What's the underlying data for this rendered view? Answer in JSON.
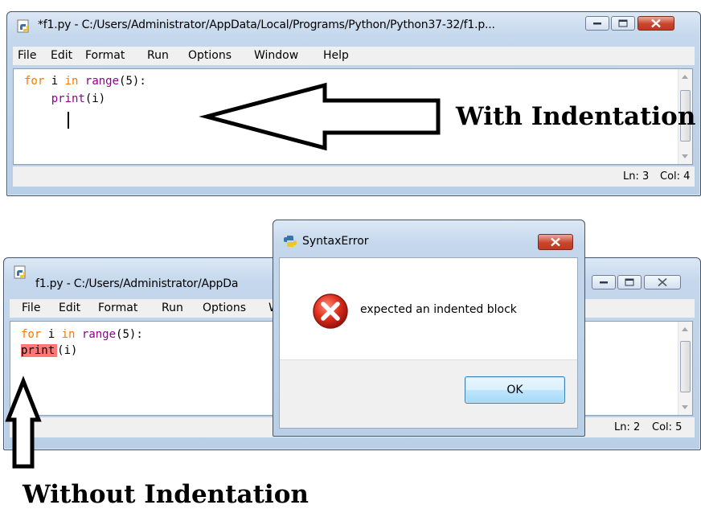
{
  "top_window": {
    "title": "*f1.py - C:/Users/Administrator/AppData/Local/Programs/Python/Python37-32/f1.p...",
    "menu": [
      "File",
      "Edit",
      "Format",
      "Run",
      "Options",
      "Window",
      "Help"
    ],
    "code": {
      "line1": {
        "kw1": "for",
        "mid": " i ",
        "kw2": "in",
        "sp": " ",
        "fn": "range",
        "rest": "(5):"
      },
      "line2": {
        "indent": "    ",
        "fn": "print",
        "rest": "(i)"
      }
    },
    "status": {
      "line": "Ln: 3",
      "col": "Col: 4"
    }
  },
  "bottom_window": {
    "title": "f1.py - C:/Users/Administrator/AppDa",
    "menu": [
      "File",
      "Edit",
      "Format",
      "Run",
      "Options",
      "W"
    ],
    "code": {
      "line1": {
        "kw1": "for",
        "mid": " i ",
        "kw2": "in",
        "sp": " ",
        "fn": "range",
        "rest": "(5):"
      },
      "line2": {
        "fn": "print",
        "rest": "(i)"
      }
    },
    "status": {
      "line": "Ln: 2",
      "col": "Col: 5"
    }
  },
  "dialog": {
    "title": "SyntaxError",
    "message": "expected an indented block",
    "ok_label": "OK"
  },
  "annotations": {
    "with": "With Indentation",
    "without": "Without Indentation"
  },
  "colors": {
    "keyword": "#ff7700",
    "builtin": "#900090",
    "error_highlight": "#ff7777",
    "close_button": "#c8452c"
  }
}
